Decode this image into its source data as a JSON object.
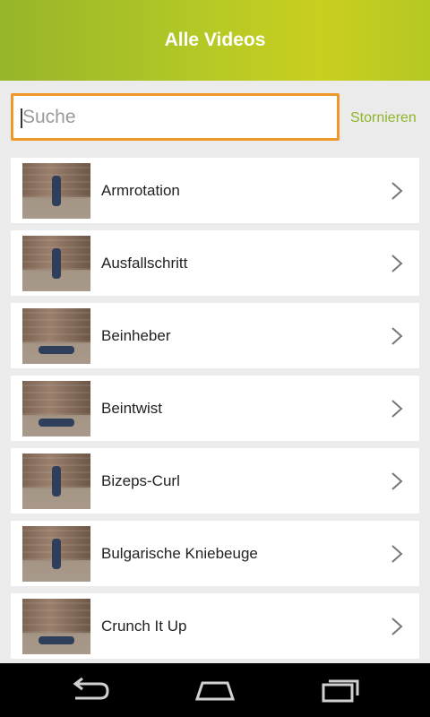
{
  "header": {
    "title": "Alle Videos"
  },
  "search": {
    "placeholder": "Suche",
    "value": "",
    "cancel_label": "Stornieren"
  },
  "list": {
    "items": [
      {
        "label": "Armrotation",
        "pose": "standing"
      },
      {
        "label": "Ausfallschritt",
        "pose": "standing"
      },
      {
        "label": "Beinheber",
        "pose": "lying"
      },
      {
        "label": "Beintwist",
        "pose": "lying"
      },
      {
        "label": "Bizeps-Curl",
        "pose": "standing"
      },
      {
        "label": "Bulgarische Kniebeuge",
        "pose": "standing"
      },
      {
        "label": "Crunch It Up",
        "pose": "lying"
      }
    ]
  },
  "icons": {
    "chevron": "chevron-right-icon",
    "nav_back": "back-icon",
    "nav_home": "home-icon",
    "nav_recents": "recent-apps-icon"
  },
  "colors": {
    "header_start": "#97b52a",
    "header_end": "#c9cf1f",
    "accent_green": "#8fb52a",
    "focus_orange": "#f0972a"
  }
}
